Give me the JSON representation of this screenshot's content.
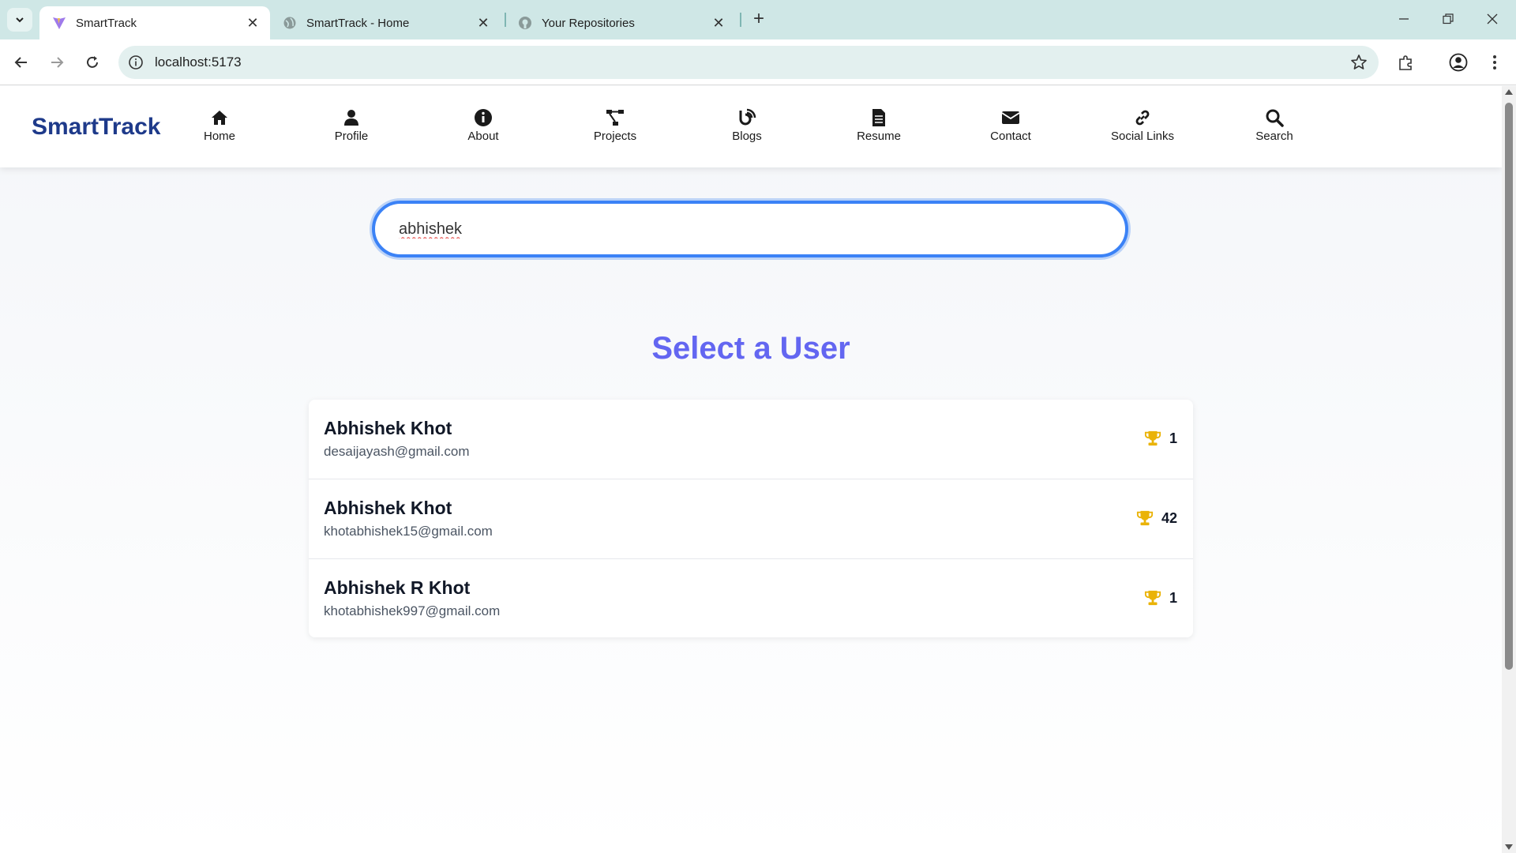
{
  "browser": {
    "tabs": [
      {
        "title": "SmartTrack",
        "active": true
      },
      {
        "title": "SmartTrack - Home",
        "active": false
      },
      {
        "title": "Your Repositories",
        "active": false
      }
    ],
    "url": "localhost:5173"
  },
  "navbar": {
    "brand": "SmartTrack",
    "items": [
      {
        "label": "Home",
        "icon": "home-icon"
      },
      {
        "label": "Profile",
        "icon": "user-icon"
      },
      {
        "label": "About",
        "icon": "info-icon"
      },
      {
        "label": "Projects",
        "icon": "project-diagram-icon"
      },
      {
        "label": "Blogs",
        "icon": "blog-icon"
      },
      {
        "label": "Resume",
        "icon": "file-icon"
      },
      {
        "label": "Contact",
        "icon": "envelope-icon"
      },
      {
        "label": "Social Links",
        "icon": "link-icon"
      },
      {
        "label": "Search",
        "icon": "search-icon"
      }
    ]
  },
  "search": {
    "value": "abhishek"
  },
  "heading": "Select a User",
  "users": [
    {
      "name": "Abhishek Khot",
      "email": "desaijayash@gmail.com",
      "score": "1"
    },
    {
      "name": "Abhishek Khot",
      "email": "khotabhishek15@gmail.com",
      "score": "42"
    },
    {
      "name": "Abhishek R Khot",
      "email": "khotabhishek997@gmail.com",
      "score": "1"
    }
  ],
  "colors": {
    "brand": "#1e3a8a",
    "heading": "#6366f1",
    "search_border": "#3b82f6",
    "trophy": "#eab308"
  }
}
